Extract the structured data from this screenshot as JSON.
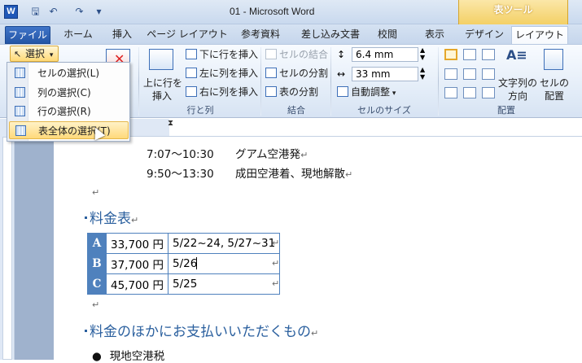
{
  "titlebar": {
    "app_icon": "W",
    "title": "01 - Microsoft Word",
    "quick_access": [
      "save-icon",
      "undo-icon",
      "redo-icon",
      "customize-icon"
    ]
  },
  "contextual_tab_group": "表ツール",
  "tabs": [
    {
      "label": "ファイル"
    },
    {
      "label": "ホーム"
    },
    {
      "label": "挿入"
    },
    {
      "label": "ページ レイアウト"
    },
    {
      "label": "参考資料"
    },
    {
      "label": "差し込み文書"
    },
    {
      "label": "校閲"
    },
    {
      "label": "表示"
    },
    {
      "label": "デザイン"
    },
    {
      "label": "レイアウト"
    }
  ],
  "ribbon": {
    "select_button": "選択",
    "rows_cols": {
      "insert_above_line1": "上に行を",
      "insert_above_line2": "挿入",
      "insert_below": "下に行を挿入",
      "insert_left": "左に列を挿入",
      "insert_right": "右に列を挿入",
      "group_label": "行と列"
    },
    "merge": {
      "merge_cells": "セルの結合",
      "split_cells": "セルの分割",
      "split_table": "表の分割",
      "group_label": "結合"
    },
    "cell_size": {
      "height": "6.4 mm",
      "width": "33 mm",
      "autofit": "自動調整",
      "group_label": "セルのサイズ"
    },
    "alignment": {
      "text_direction_line1": "文字列の",
      "text_direction_line2": "方向",
      "cell_margins_line1": "セルの",
      "cell_margins_line2": "配置",
      "group_label": "配置"
    }
  },
  "select_menu": {
    "items": [
      {
        "label": "セルの選択(L)"
      },
      {
        "label": "列の選択(C)"
      },
      {
        "label": "行の選択(R)"
      },
      {
        "label": "表全体の選択(T)"
      }
    ]
  },
  "document": {
    "schedule": [
      {
        "time": "7:07～10:30",
        "text": "グアム空港発"
      },
      {
        "time": "9:50～13:30",
        "text": "成田空港着、現地解散"
      }
    ],
    "heading1": "料金表",
    "table": [
      {
        "key": "A",
        "price": "33,700 円",
        "dates": "5/22~24, 5/27~31"
      },
      {
        "key": "B",
        "price": "37,700 円",
        "dates": "5/26"
      },
      {
        "key": "C",
        "price": "45,700 円",
        "dates": "5/25"
      }
    ],
    "heading2": "料金のほかにお支払いいただくもの",
    "bullet1": "現地空港税"
  },
  "colors": {
    "accent": "#4f81bd",
    "heading": "#2a5f9e",
    "file_tab": "#2456a6",
    "contextual": "#f3cf63"
  }
}
